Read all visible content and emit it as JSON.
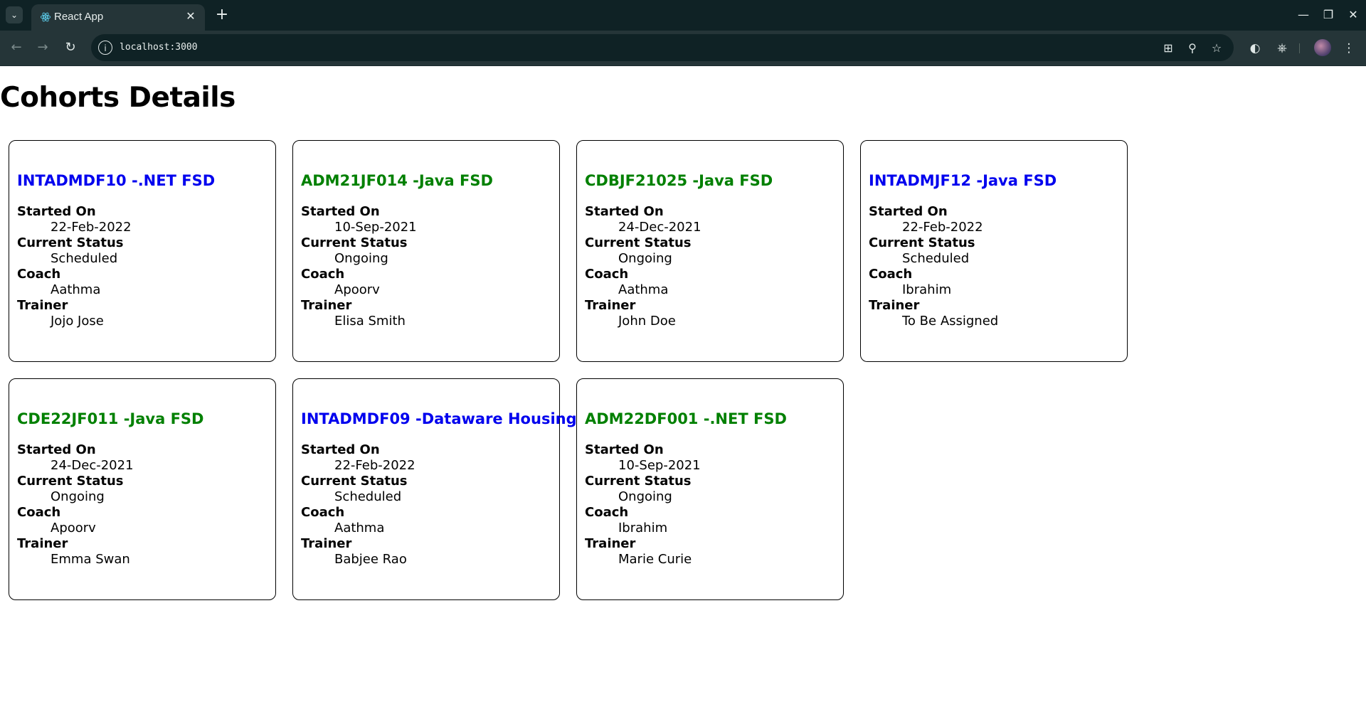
{
  "browser": {
    "tab_title": "React App",
    "url": "localhost:3000"
  },
  "page": {
    "title": "Cohorts Details",
    "labels": {
      "started_on": "Started On",
      "current_status": "Current Status",
      "coach": "Coach",
      "trainer": "Trainer"
    },
    "cohorts": [
      {
        "name": "INTADMDF10 -.NET FSD",
        "title_color": "blue",
        "started_on": "22-Feb-2022",
        "status": "Scheduled",
        "coach": "Aathma",
        "trainer": "Jojo Jose"
      },
      {
        "name": "ADM21JF014 -Java FSD",
        "title_color": "green",
        "started_on": "10-Sep-2021",
        "status": "Ongoing",
        "coach": "Apoorv",
        "trainer": "Elisa Smith"
      },
      {
        "name": "CDBJF21025 -Java FSD",
        "title_color": "green",
        "started_on": "24-Dec-2021",
        "status": "Ongoing",
        "coach": "Aathma",
        "trainer": "John Doe"
      },
      {
        "name": "INTADMJF12 -Java FSD",
        "title_color": "blue",
        "started_on": "22-Feb-2022",
        "status": "Scheduled",
        "coach": "Ibrahim",
        "trainer": "To Be Assigned"
      },
      {
        "name": "CDE22JF011 -Java FSD",
        "title_color": "green",
        "started_on": "24-Dec-2021",
        "status": "Ongoing",
        "coach": "Apoorv",
        "trainer": "Emma Swan"
      },
      {
        "name": "INTADMDF09 -Dataware Housing",
        "title_color": "blue",
        "started_on": "22-Feb-2022",
        "status": "Scheduled",
        "coach": "Aathma",
        "trainer": "Babjee Rao"
      },
      {
        "name": "ADM22DF001 -.NET FSD",
        "title_color": "green",
        "started_on": "10-Sep-2021",
        "status": "Ongoing",
        "coach": "Ibrahim",
        "trainer": "Marie Curie"
      }
    ]
  },
  "colors": {
    "blue_title": "#0000ee",
    "green_title": "#008000",
    "chrome_dark": "#0f2225",
    "chrome_toolbar": "#253538"
  }
}
